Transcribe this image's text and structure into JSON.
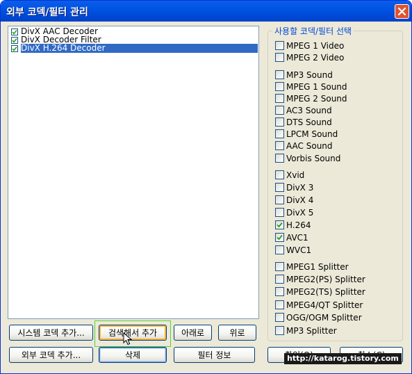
{
  "window": {
    "title": "외부 코덱/필터 관리"
  },
  "codec_list": {
    "items": [
      {
        "label": "DivX AAC Decoder",
        "checked": true,
        "selected": false
      },
      {
        "label": "DivX Decoder Filter",
        "checked": true,
        "selected": false
      },
      {
        "label": "DivX H.264 Decoder",
        "checked": true,
        "selected": true
      }
    ]
  },
  "buttons": {
    "add_system_codec": "시스템 코덱 추가...",
    "search_and_add": "검색해서 추가",
    "down": "아래로",
    "up": "위로",
    "add_external_codec": "외부 코덱 추가...",
    "delete": "삭제",
    "filter_info": "필터 정보",
    "ok": "확인(O)",
    "cancel": "취소(C)"
  },
  "codec_group": {
    "title": "사용할 코덱/필터 선택",
    "options": [
      {
        "label": "MPEG 1 Video",
        "checked": false
      },
      {
        "label": "MPEG 2 Video",
        "checked": false
      },
      {
        "label": "MP3 Sound",
        "checked": false
      },
      {
        "label": "MPEG 1 Sound",
        "checked": false
      },
      {
        "label": "MPEG 2 Sound",
        "checked": false
      },
      {
        "label": "AC3 Sound",
        "checked": false
      },
      {
        "label": "DTS Sound",
        "checked": false
      },
      {
        "label": "LPCM Sound",
        "checked": false
      },
      {
        "label": "AAC Sound",
        "checked": false
      },
      {
        "label": "Vorbis Sound",
        "checked": false
      },
      {
        "label": "Xvid",
        "checked": false
      },
      {
        "label": "DivX 3",
        "checked": false
      },
      {
        "label": "DivX 4",
        "checked": false
      },
      {
        "label": "DivX 5",
        "checked": false
      },
      {
        "label": "H.264",
        "checked": true
      },
      {
        "label": "AVC1",
        "checked": true
      },
      {
        "label": "WVC1",
        "checked": false
      },
      {
        "label": "MPEG1 Splitter",
        "checked": false
      },
      {
        "label": "MPEG2(PS) Splitter",
        "checked": false
      },
      {
        "label": "MPEG2(TS) Splitter",
        "checked": false
      },
      {
        "label": "MPEG4/QT Splitter",
        "checked": false
      },
      {
        "label": "OGG/OGM Splitter",
        "checked": false
      },
      {
        "label": "MP3 Splitter",
        "checked": false
      }
    ]
  },
  "watermark": "http://katarog.tistory.com",
  "colors": {
    "title_bar": "#0054e3",
    "selection": "#316ac5",
    "close_button": "#e1532e",
    "dialog_bg": "#ece9d8"
  }
}
